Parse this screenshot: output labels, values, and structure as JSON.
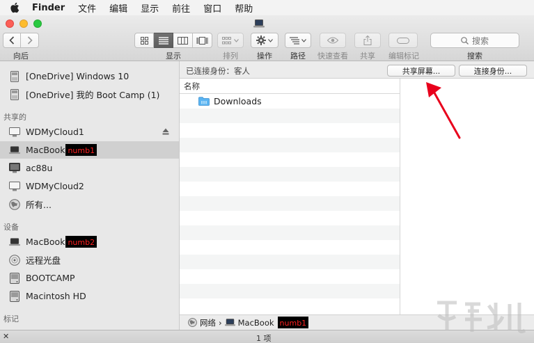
{
  "menubar": {
    "app": "Finder",
    "items": [
      "文件",
      "编辑",
      "显示",
      "前往",
      "窗口",
      "帮助"
    ]
  },
  "toolbar": {
    "nav_label": "向后",
    "view_label": "显示",
    "arrange_label": "排列",
    "action_label": "操作",
    "path_label": "路径",
    "quicklook_label": "快速查看",
    "share_label": "共享",
    "tags_label": "编辑标记",
    "search_placeholder": "搜索",
    "search_label": "搜索"
  },
  "sidebar": {
    "top_items": [
      {
        "label": "[OneDrive] Windows 10",
        "icon": "disk-icon"
      },
      {
        "label": "[OneDrive] 我的 Boot Camp (1)",
        "icon": "disk-icon"
      }
    ],
    "shared_header": "共享的",
    "shared_items": [
      {
        "label": "WDMyCloud1",
        "icon": "monitor-icon"
      },
      {
        "label": "MacBook",
        "icon": "laptop-icon",
        "redacted": "numb1"
      },
      {
        "label": "ac88u",
        "icon": "server-icon"
      },
      {
        "label": "WDMyCloud2",
        "icon": "monitor-icon"
      },
      {
        "label": "所有...",
        "icon": "globe-icon"
      }
    ],
    "devices_header": "设备",
    "device_items": [
      {
        "label": "MacBook",
        "icon": "laptop-icon",
        "redacted": "numb2"
      },
      {
        "label": "远程光盘",
        "icon": "optical-disc-icon"
      },
      {
        "label": "BOOTCAMP",
        "icon": "drive-icon"
      },
      {
        "label": "Macintosh HD",
        "icon": "drive-icon"
      }
    ],
    "tags_header": "标记"
  },
  "main": {
    "connected_as": "已连接身份：客人",
    "share_screen_button": "共享屏幕...",
    "connect_as_button": "连接身份...",
    "column_name": "名称",
    "files": [
      {
        "name": "Downloads",
        "icon": "folder-icon"
      }
    ]
  },
  "pathbar": {
    "network": "网络",
    "separator": "›",
    "machine": "MacBook",
    "redacted": "numb1"
  },
  "statusbar": {
    "count": "1 项",
    "close_glyph": "✕"
  },
  "colors": {
    "selection": "#d0d0d0",
    "redact_text": "#ff2020",
    "annotation_arrow": "#e8001c",
    "folder": "#5ab4f2"
  }
}
